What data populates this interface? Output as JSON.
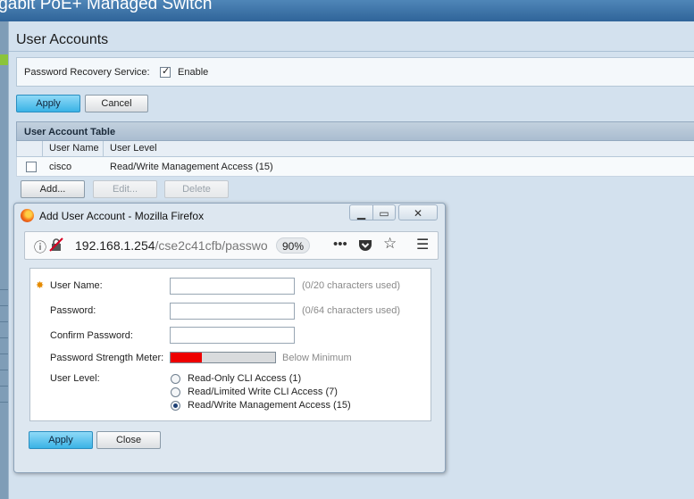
{
  "banner": {
    "title": "igabit PoE+ Managed Switch"
  },
  "page": {
    "title": "User Accounts"
  },
  "password_recovery": {
    "label": "Password Recovery Service:",
    "enable_label": "Enable",
    "enabled": true
  },
  "buttons": {
    "apply": "Apply",
    "cancel": "Cancel"
  },
  "user_table": {
    "title": "User Account Table",
    "columns": [
      "User Name",
      "User Level"
    ],
    "rows": [
      {
        "user_name": "cisco",
        "user_level": "Read/Write Management Access (15)",
        "selected": false
      }
    ],
    "actions": {
      "add": "Add...",
      "edit": "Edit...",
      "delete": "Delete"
    }
  },
  "popup": {
    "window_title": "Add User Account - Mozilla Firefox",
    "url_host": "192.168.1.254",
    "url_path": "/cse2c41cfb/passwo",
    "zoom": "90%",
    "toolbar_icons": [
      "info-icon",
      "insecure-lock-icon",
      "more-icon",
      "pocket-icon",
      "bookmark-star-icon",
      "hamburger-menu-icon"
    ],
    "form": {
      "user_name": {
        "label": "User Name:",
        "value": "",
        "hint": "(0/20 characters used)",
        "required": true
      },
      "password": {
        "label": "Password:",
        "value": "",
        "hint": "(0/64 characters used)"
      },
      "confirm_password": {
        "label": "Confirm Password:",
        "value": ""
      },
      "strength": {
        "label": "Password Strength Meter:",
        "status": "Below Minimum",
        "level_fraction": 0.3,
        "color": "#ee0000"
      },
      "user_level": {
        "label": "User Level:",
        "options": [
          "Read-Only CLI Access (1)",
          "Read/Limited Write CLI Access (7)",
          "Read/Write Management Access (15)"
        ],
        "selected": "Read/Write Management Access (15)"
      }
    },
    "buttons": {
      "apply": "Apply",
      "close": "Close"
    }
  },
  "colors": {
    "accent_button": "#3ab3e6",
    "banner": "#2f6499",
    "required_marker": "#e58a00"
  }
}
